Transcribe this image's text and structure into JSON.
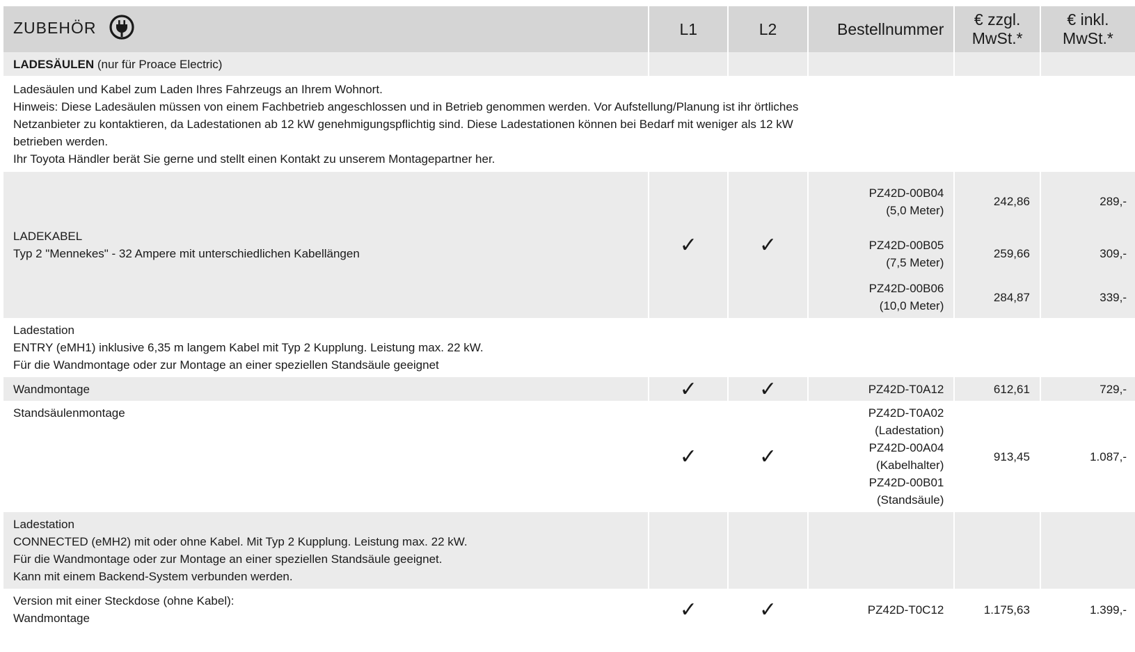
{
  "header": {
    "title": "ZUBEHÖR",
    "col_l1": "L1",
    "col_l2": "L2",
    "col_order": "Bestellnummer",
    "col_net": "€ zzgl. MwSt.*",
    "col_gross": "€ inkl. MwSt.*",
    "icon": "plug-icon"
  },
  "section": {
    "title": "LADESÄULEN",
    "subtitle": " (nur für Proace Electric)"
  },
  "note": {
    "lines": [
      "Ladesäulen und Kabel zum Laden Ihres Fahrzeugs an Ihrem Wohnort.",
      "Hinweis: Diese Ladesäulen müssen von einem Fachbetrieb angeschlossen und in Betrieb genommen werden. Vor Aufstellung/Planung ist ihr örtliches",
      "Netzanbieter zu kontaktieren, da Ladestationen ab 12 kW  genehmigungspflichtig sind. Diese Ladestationen können bei Bedarf mit weniger als 12 kW",
      "betrieben werden.",
      "Ihr Toyota Händler berät Sie gerne und stellt einen Kontakt zu unserem Montagepartner her."
    ]
  },
  "check": "✓",
  "cable": {
    "title": "LADEKABEL",
    "desc": "Typ 2 \"Mennekes\" - 32 Ampere mit unterschiedlichen Kabellängen",
    "items": [
      {
        "order": "PZ42D-00B04",
        "length": "(5,0 Meter)",
        "net": "242,86",
        "gross": "289,-"
      },
      {
        "order": "PZ42D-00B05",
        "length": "(7,5 Meter)",
        "net": "259,66",
        "gross": "309,-"
      },
      {
        "order": "PZ42D-00B06",
        "length": "(10,0 Meter)",
        "net": "284,87",
        "gross": "339,-"
      }
    ]
  },
  "entry": {
    "lines": [
      "Ladestation",
      "ENTRY (eMH1) inklusive 6,35 m langem Kabel mit Typ 2 Kupplung. Leistung max. 22 kW.",
      "Für die Wandmontage oder zur Montage an einer speziellen Standsäule geeignet"
    ]
  },
  "wall": {
    "label": "Wandmontage",
    "order": "PZ42D-T0A12",
    "net": "612,61",
    "gross": "729,-"
  },
  "stand": {
    "label": "Standsäulenmontage",
    "order_lines": [
      "PZ42D-T0A02",
      "(Ladestation)",
      "PZ42D-00A04",
      "(Kabelhalter)",
      "PZ42D-00B01",
      "(Standsäule)"
    ],
    "net": "913,45",
    "gross": "1.087,-"
  },
  "connected": {
    "lines": [
      "Ladestation",
      "CONNECTED (eMH2) mit oder ohne Kabel. Mit Typ 2 Kupplung. Leistung max. 22 kW.",
      "Für die Wandmontage oder zur Montage an einer speziellen Standsäule geeignet.",
      "Kann mit einem Backend-System verbunden werden."
    ]
  },
  "socket": {
    "lines": [
      "Version mit einer Steckdose (ohne Kabel):",
      "Wandmontage"
    ],
    "order": "PZ42D-T0C12",
    "net": "1.175,63",
    "gross": "1.399,-"
  }
}
